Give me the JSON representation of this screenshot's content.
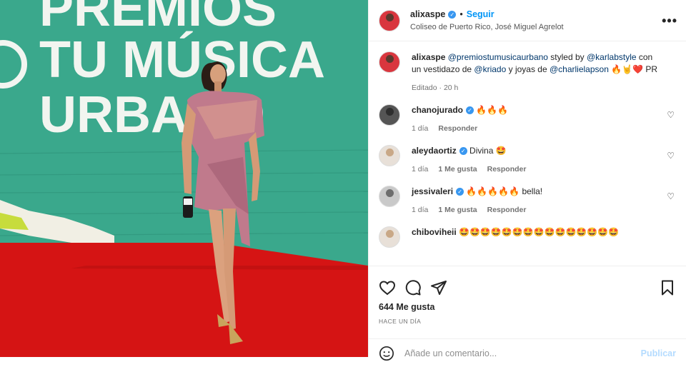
{
  "photo": {
    "backdrop_lines": [
      "PREMIOS",
      "TU MÚSICA",
      "URBANO"
    ],
    "colors": {
      "backdrop": "#3aa88c",
      "carpet": "#d51414",
      "dress": "#c07a8c"
    }
  },
  "header": {
    "username": "alixaspe",
    "separator": "•",
    "follow_label": "Seguir",
    "location": "Coliseo de Puerto Rico, José Miguel Agrelot",
    "more_label": "•••"
  },
  "caption": {
    "username": "alixaspe",
    "parts": [
      {
        "type": "mention",
        "text": "@premiostumusicaurbano"
      },
      {
        "type": "text",
        "text": " styled by "
      },
      {
        "type": "mention",
        "text": "@karlabstyle"
      },
      {
        "type": "text",
        "text": " con un vestidazo de "
      },
      {
        "type": "mention",
        "text": "@kriado"
      },
      {
        "type": "text",
        "text": " y joyas de "
      },
      {
        "type": "mention",
        "text": "@charlielapson"
      },
      {
        "type": "text",
        "text": " 🔥🤘❤️ PR"
      }
    ],
    "edited": "Editado · 20 h"
  },
  "comments": [
    {
      "username": "chanojurado",
      "text": "🔥🔥🔥",
      "time": "1 día",
      "likes": "",
      "reply": "Responder",
      "avatar": "dark"
    },
    {
      "username": "aleydaortiz",
      "text": "Divina 🤩",
      "time": "1 día",
      "likes": "1 Me gusta",
      "reply": "Responder",
      "avatar": "light"
    },
    {
      "username": "jessivaleri",
      "text": "🔥🔥🔥🔥🔥 bella!",
      "time": "1 día",
      "likes": "1 Me gusta",
      "reply": "Responder",
      "avatar": "grey"
    },
    {
      "username": "chiboviheii",
      "text": "🤩🤩🤩🤩🤩🤩🤩🤩🤩🤩🤩🤩🤩🤩🤩",
      "time": "",
      "likes": "",
      "reply": "",
      "avatar": "light"
    }
  ],
  "actions": {
    "likes": "644 Me gusta",
    "posted_ago": "HACE UN DÍA",
    "icons": [
      "heart-icon",
      "comment-icon",
      "share-icon",
      "bookmark-icon"
    ]
  },
  "composer": {
    "placeholder": "Añade un comentario...",
    "publish_label": "Publicar"
  }
}
